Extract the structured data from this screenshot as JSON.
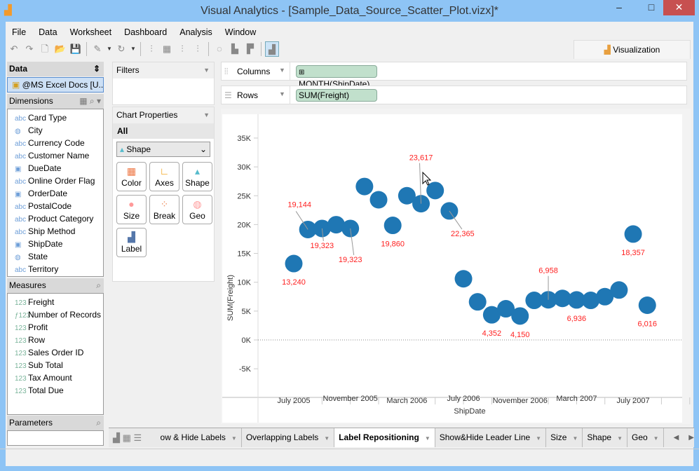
{
  "window": {
    "title": "Visual Analytics - [Sample_Data_Source_Scatter_Plot.vizx]*",
    "minimize": "–",
    "maximize": "□",
    "close": "✕"
  },
  "menu": [
    "File",
    "Data",
    "Worksheet",
    "Dashboard",
    "Analysis",
    "Window"
  ],
  "toolbar": [
    "undo-icon",
    "redo-icon",
    "new-icon",
    "open-icon",
    "save-icon",
    "data-connect-icon",
    "refresh-icon",
    "add-chart-icon",
    "add-dashboard-icon",
    "remove-chart-icon",
    "clear-icon",
    "lasso-icon",
    "sort-asc-icon",
    "sort-desc-icon",
    "label-icon"
  ],
  "visualization_tab": "Visualization",
  "data_panel": {
    "title": "Data",
    "source": "@MS Excel Docs [U...",
    "dimensions_title": "Dimensions",
    "dimensions": [
      {
        "type": "abc",
        "name": "Card Type"
      },
      {
        "type": "geo",
        "name": "City"
      },
      {
        "type": "abc",
        "name": "Currency Code"
      },
      {
        "type": "abc",
        "name": "Customer Name"
      },
      {
        "type": "date",
        "name": "DueDate"
      },
      {
        "type": "abc",
        "name": "Online Order Flag"
      },
      {
        "type": "date",
        "name": "OrderDate"
      },
      {
        "type": "abc",
        "name": "PostalCode"
      },
      {
        "type": "abc",
        "name": "Product Category"
      },
      {
        "type": "abc",
        "name": "Ship Method"
      },
      {
        "type": "date",
        "name": "ShipDate"
      },
      {
        "type": "geo",
        "name": "State"
      },
      {
        "type": "abc",
        "name": "Territory"
      }
    ],
    "measures_title": "Measures",
    "measures": [
      {
        "type": "123",
        "name": "Freight"
      },
      {
        "type": "f123",
        "name": "Number of Records"
      },
      {
        "type": "123",
        "name": "Profit"
      },
      {
        "type": "123",
        "name": "Row"
      },
      {
        "type": "123",
        "name": "Sales Order ID"
      },
      {
        "type": "123",
        "name": "Sub Total"
      },
      {
        "type": "123",
        "name": "Tax Amount"
      },
      {
        "type": "123",
        "name": "Total Due"
      }
    ],
    "parameters_title": "Parameters"
  },
  "filters": {
    "title": "Filters"
  },
  "chart_properties": {
    "title": "Chart Properties",
    "scope": "All",
    "mark_type": "Shape",
    "buttons": [
      "Color",
      "Axes",
      "Shape",
      "Size",
      "Break",
      "Geo",
      "Label"
    ]
  },
  "shelves": {
    "columns_label": "Columns",
    "columns_pill": "MONTH(ShipDate)",
    "rows_label": "Rows",
    "rows_pill": "SUM(Freight)"
  },
  "tabs": [
    "ow & Hide Labels",
    "Overlapping Labels",
    "Label Repositioning",
    "Show&Hide Leader Line",
    "Size",
    "Shape",
    "Geo"
  ],
  "active_tab": "Label Repositioning",
  "chart_data": {
    "type": "scatter",
    "xlabel": "ShipDate",
    "ylabel": "SUM(Freight)",
    "ylim": [
      -10000,
      39000
    ],
    "yticks": [
      "-5K",
      "0K",
      "5K",
      "10K",
      "15K",
      "20K",
      "25K",
      "30K",
      "35K"
    ],
    "ytick_values": [
      -5000,
      0,
      5000,
      10000,
      15000,
      20000,
      25000,
      30000,
      35000
    ],
    "xtick_labels": [
      "July 2005",
      "November 2005",
      "March 2006",
      "July 2006",
      "November 2006",
      "March 2007",
      "July 2007"
    ],
    "x": [
      "2005-07",
      "2005-08",
      "2005-09",
      "2005-10",
      "2005-11",
      "2005-12",
      "2006-01",
      "2006-02",
      "2006-03",
      "2006-04",
      "2006-05",
      "2006-06",
      "2006-07",
      "2006-08",
      "2006-09",
      "2006-10",
      "2006-11",
      "2006-12",
      "2007-01",
      "2007-02",
      "2007-03",
      "2007-04",
      "2007-05",
      "2007-06",
      "2007-07",
      "2007-08"
    ],
    "y": [
      13240,
      19144,
      19323,
      19980,
      19323,
      26600,
      24300,
      19860,
      25000,
      23617,
      25900,
      22365,
      10600,
      6600,
      4352,
      5400,
      4150,
      6860,
      6958,
      7200,
      6936,
      6860,
      7500,
      8650,
      18357,
      6016
    ],
    "labels": [
      "13,240",
      "19,144",
      "19,323",
      null,
      "19,323",
      null,
      null,
      "19,860",
      null,
      "23,617",
      null,
      "22,365",
      null,
      null,
      "4,352",
      null,
      "4,150",
      null,
      "6,958",
      null,
      "6,936",
      null,
      null,
      null,
      "18,357",
      "6,016"
    ],
    "marker_color": "#1f77b4",
    "label_color": "#ff2020"
  }
}
